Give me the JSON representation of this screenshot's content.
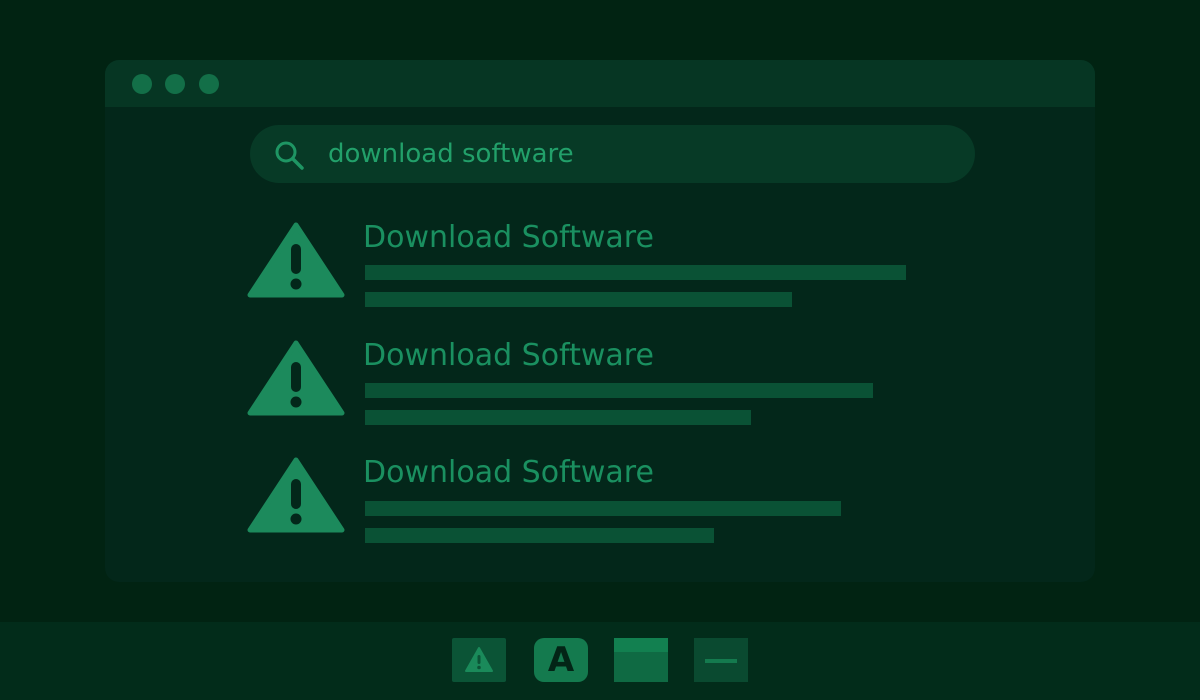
{
  "window": {
    "controls": [
      "close",
      "minimize",
      "maximize"
    ]
  },
  "search": {
    "value": "download software",
    "icon": "search-icon"
  },
  "results": [
    {
      "title": "Download Software",
      "icon": "warning-icon"
    },
    {
      "title": "Download Software",
      "icon": "warning-icon"
    },
    {
      "title": "Download Software",
      "icon": "warning-icon"
    }
  ],
  "taskbar": {
    "items": [
      {
        "icon": "warning-icon"
      },
      {
        "label": "A",
        "icon": "app-a-icon"
      },
      {
        "icon": "window-icon"
      },
      {
        "icon": "minimize-icon"
      }
    ]
  },
  "colors": {
    "background": "#012312",
    "accent": "#1a9060",
    "warning": "#1c8a5c"
  }
}
